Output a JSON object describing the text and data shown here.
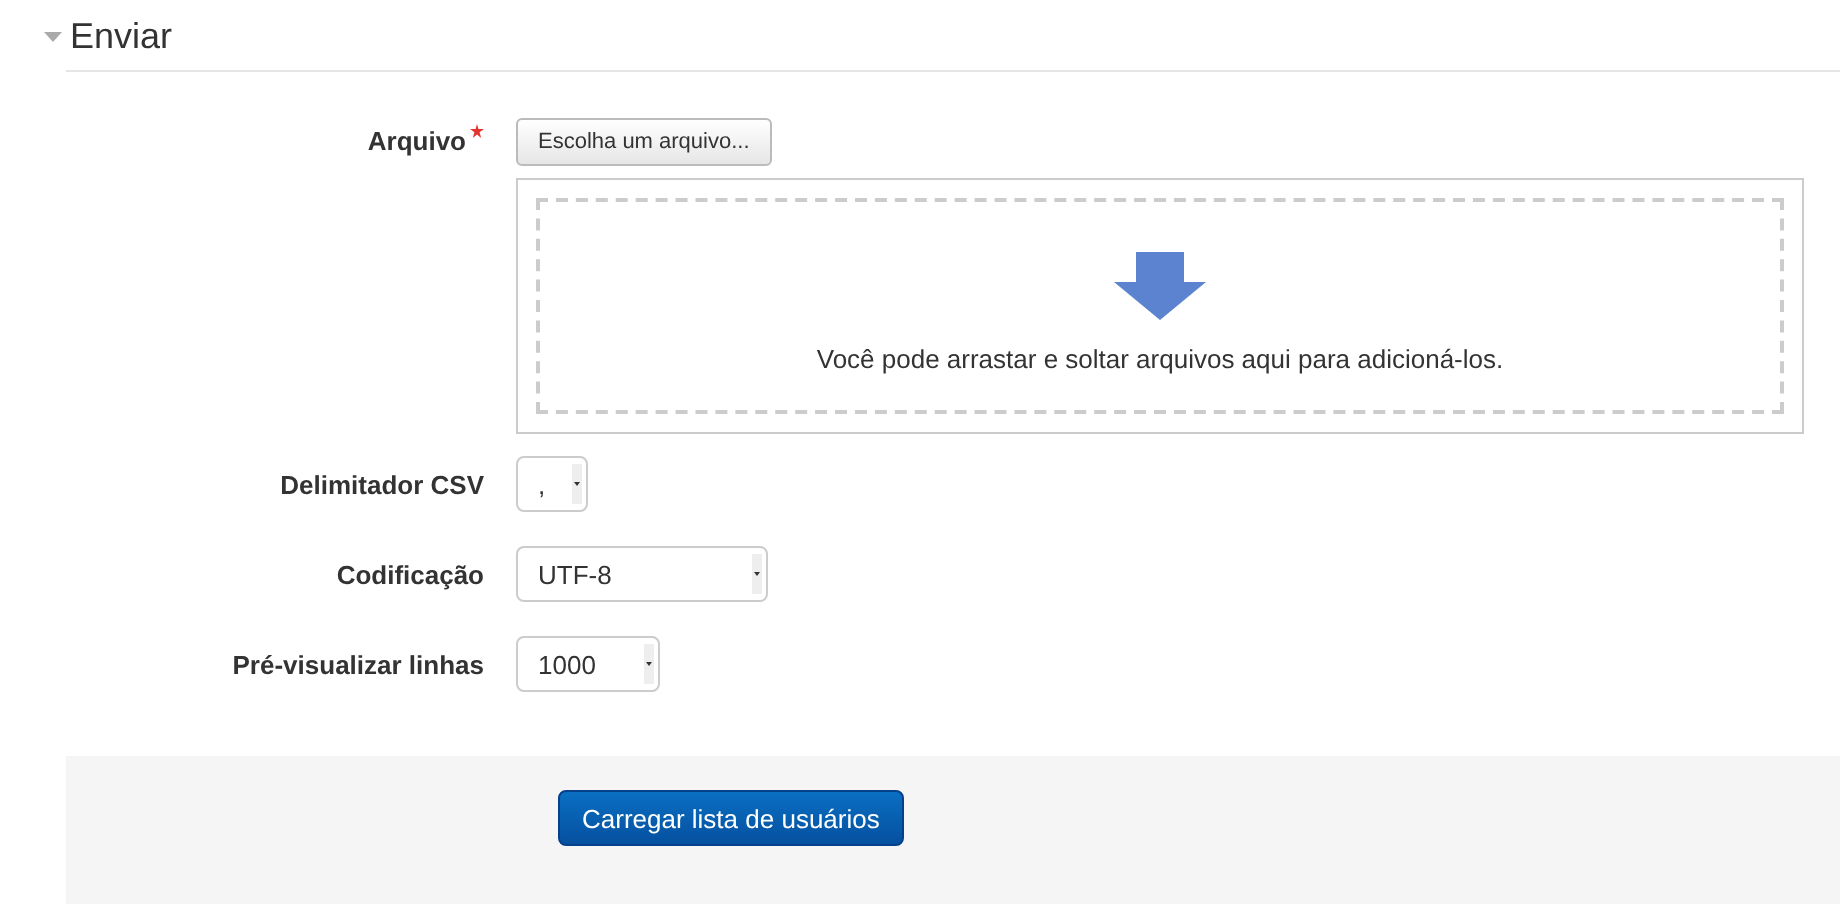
{
  "section": {
    "title": "Enviar",
    "expanded": true
  },
  "file_field": {
    "label": "Arquivo",
    "required": true,
    "button": "Escolha um arquivo...",
    "dropzone_text": "Você pode arrastar e soltar arquivos aqui para adicioná-los."
  },
  "selects": [
    {
      "label": "Delimitador CSV",
      "value": ","
    },
    {
      "label": "Codificação",
      "value": "UTF-8"
    },
    {
      "label": "Pré-visualizar linhas",
      "value": "1000"
    }
  ],
  "submit_button": "Carregar lista de usuários"
}
